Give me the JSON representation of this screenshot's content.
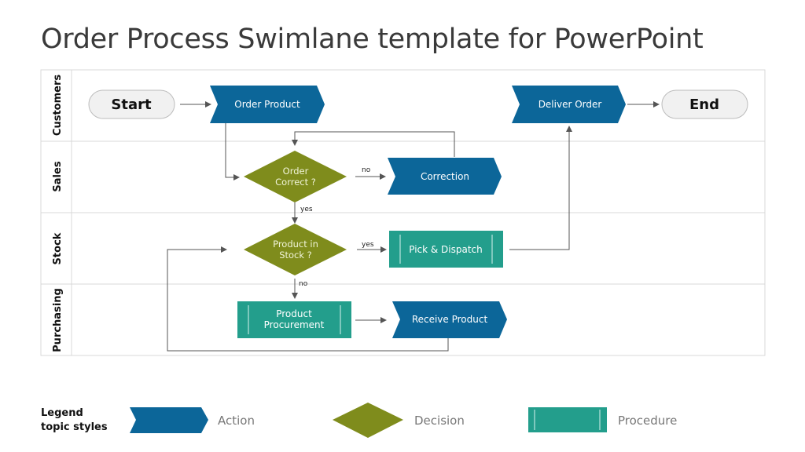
{
  "title": "Order Process Swimlane template for PowerPoint",
  "colors": {
    "action": "#0c6699",
    "decision": "#7f8c1c",
    "procedure": "#239e8c",
    "terminal_fill": "#f1f1f1",
    "lane_border": "#d9d9d9",
    "connector": "#555555"
  },
  "lanes": [
    {
      "label": "Customers"
    },
    {
      "label": "Sales"
    },
    {
      "label": "Stock"
    },
    {
      "label": "Purchasing"
    }
  ],
  "nodes": {
    "start": {
      "label": "Start",
      "type": "terminal"
    },
    "order_product": {
      "label": "Order Product",
      "type": "action"
    },
    "deliver_order": {
      "label": "Deliver Order",
      "type": "action"
    },
    "end": {
      "label": "End",
      "type": "terminal"
    },
    "order_correct": {
      "line1": "Order",
      "line2": "Correct ?",
      "type": "decision"
    },
    "correction": {
      "label": "Correction",
      "type": "action"
    },
    "product_in_stock": {
      "line1": "Product in",
      "line2": "Stock ?",
      "type": "decision"
    },
    "pick_dispatch": {
      "label": "Pick & Dispatch",
      "type": "procedure"
    },
    "product_procurement": {
      "line1": "Product",
      "line2": "Procurement",
      "type": "procedure"
    },
    "receive_product": {
      "label": "Receive Product",
      "type": "action"
    }
  },
  "edge_labels": {
    "order_correct_no": "no",
    "order_correct_yes": "yes",
    "stock_yes": "yes",
    "stock_no": "no"
  },
  "legend": {
    "title_line1": "Legend",
    "title_line2": "topic styles",
    "items": [
      {
        "label": "Action",
        "shape": "action"
      },
      {
        "label": "Decision",
        "shape": "decision"
      },
      {
        "label": "Procedure",
        "shape": "procedure"
      }
    ]
  }
}
